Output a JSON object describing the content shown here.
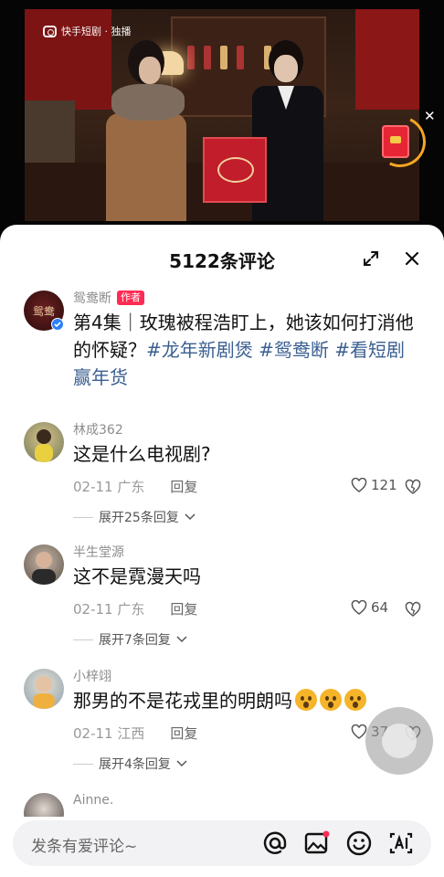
{
  "video": {
    "watermark": "快手短剧 · 独播"
  },
  "panel": {
    "title": "5122条评论"
  },
  "comments": [
    {
      "user": "鸳鸯断",
      "tag": "作者",
      "text": "第4集｜玫瑰被程浩盯上，她该如何打消他的怀疑？",
      "hashtags": "#龙年新剧煲 #鸳鸯断 #看短剧赢年货"
    },
    {
      "user": "林成362",
      "text": "这是什么电视剧?",
      "date": "02-11 广东",
      "reply": "回复",
      "likes": "121",
      "expand": "展开25条回复"
    },
    {
      "user": "半生堂源",
      "text": "这不是霓漫天吗",
      "date": "02-11 广东",
      "reply": "回复",
      "likes": "64",
      "expand": "展开7条回复"
    },
    {
      "user": "小梓翊",
      "text": "那男的不是花戎里的明朗吗",
      "date": "02-11 江西",
      "reply": "回复",
      "likes": "37",
      "expand": "展开4条回复"
    },
    {
      "user": "Ainne."
    }
  ],
  "input": {
    "placeholder": "发条有爱评论~"
  },
  "icons": {
    "at": "at-icon",
    "image": "image-icon",
    "emoji": "emoji-icon",
    "ai": "ai-icon",
    "expand": "expand-icon",
    "close": "close-icon",
    "like": "heart-icon",
    "dislike": "broken-heart-icon"
  },
  "colors": {
    "author_tag": "#fe2c55",
    "hashtag": "#3a5f91",
    "verified": "#2d7ff9",
    "redpacket": "#e62635"
  }
}
